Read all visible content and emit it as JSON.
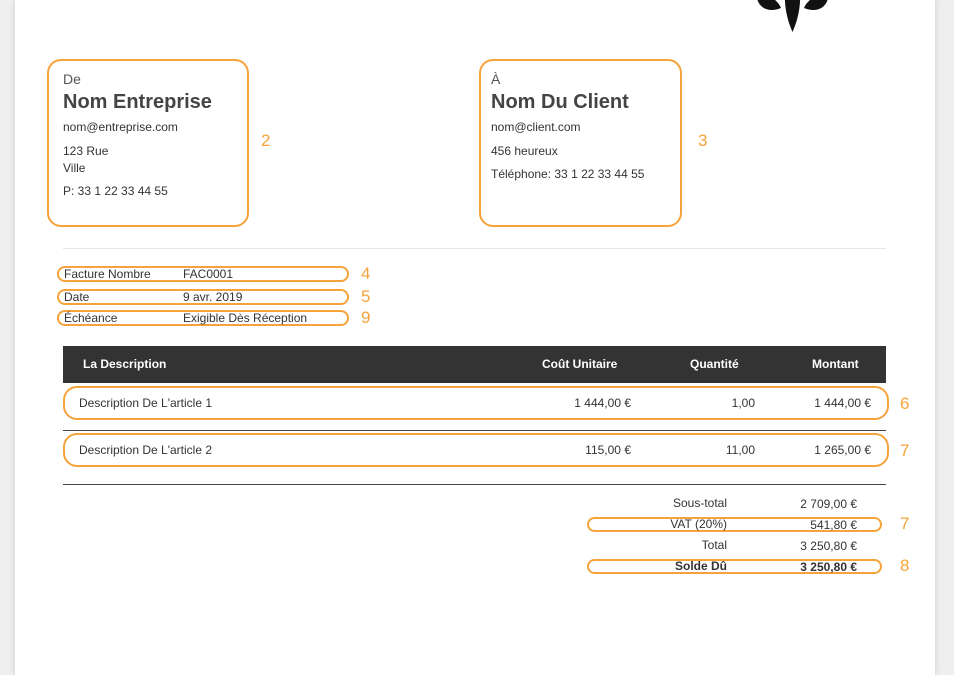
{
  "from": {
    "label": "De",
    "name": "Nom Entreprise",
    "email": "nom@entreprise.com",
    "street": "123 Rue",
    "city": "Ville",
    "phone": "P: 33 1 22 33 44 55",
    "annotation": "2"
  },
  "to": {
    "label": "À",
    "name": "Nom Du Client",
    "email": "nom@client.com",
    "address": "456 heureux",
    "phone": "Téléphone: 33 1 22 33 44 55",
    "annotation": "3"
  },
  "meta": [
    {
      "key": "Facture Nombre",
      "value": "FAC0001",
      "annotation": "4"
    },
    {
      "key": "Date",
      "value": "9 avr. 2019",
      "annotation": "5"
    },
    {
      "key": "Échéance",
      "value": "Exigible Dès Réception",
      "annotation": "9"
    }
  ],
  "table": {
    "headers": {
      "description": "La Description",
      "unit_cost": "Coût Unitaire",
      "quantity": "Quantité",
      "amount": "Montant"
    },
    "rows": [
      {
        "description": "Description De L'article 1",
        "unit_cost": "1 444,00 €",
        "quantity": "1,00",
        "amount": "1 444,00 €",
        "annotation": "6"
      },
      {
        "description": "Description De L'article 2",
        "unit_cost": "115,00 €",
        "quantity": "11,00",
        "amount": "1 265,00 €",
        "annotation": "7"
      }
    ]
  },
  "totals": {
    "subtotal_label": "Sous-total",
    "subtotal_value": "2 709,00 €",
    "vat_label": "VAT (20%)",
    "vat_value": "541,80 €",
    "vat_annotation": "7",
    "total_label": "Total",
    "total_value": "3 250,80 €",
    "due_label": "Solde Dû",
    "due_value": "3 250,80 €",
    "due_annotation": "8"
  },
  "colors": {
    "highlight": "#f5a33a",
    "header_bg": "#333333"
  }
}
